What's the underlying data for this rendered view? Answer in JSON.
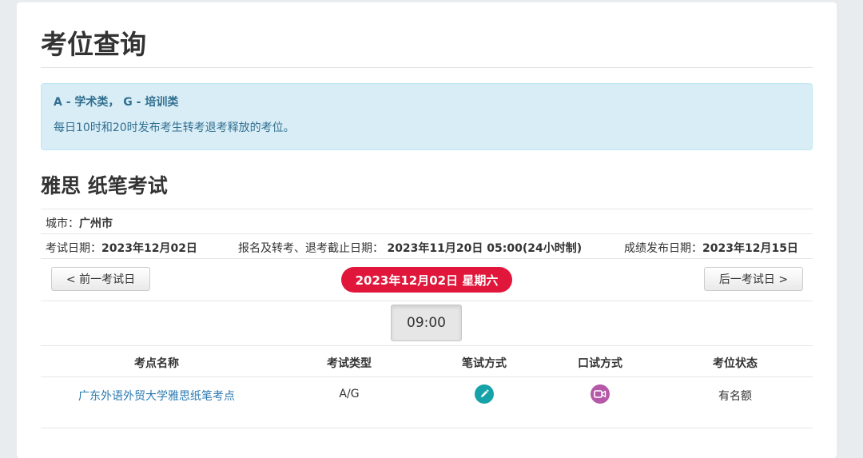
{
  "page": {
    "title": "考位查询"
  },
  "notice": {
    "legend": "A - 学术类， G - 培训类",
    "text": "每日10时和20时发布考生转考退考释放的考位。"
  },
  "exam": {
    "title": "雅思 纸笔考试"
  },
  "info": {
    "city_label": "城市：",
    "city_value": "广州市",
    "exam_date_label": "考试日期：",
    "exam_date_value": "2023年12月02日",
    "deadline_label": "报名及转考、退考截止日期：",
    "deadline_value": "2023年11月20日 05:00(24小时制)",
    "result_label": "成绩发布日期：",
    "result_value": "2023年12月15日"
  },
  "nav": {
    "prev_label": "< 前一考试日",
    "current_date": "2023年12月02日 星期六",
    "next_label": "后一考试日 >",
    "time_slot": "09:00",
    "current_color": "#e0173a"
  },
  "table": {
    "headers": [
      "考点名称",
      "考试类型",
      "笔试方式",
      "口试方式",
      "考位状态"
    ],
    "rows": [
      {
        "center": "广东外语外贸大学雅思纸笔考点",
        "type": "A/G",
        "written_icon": "pencil-icon",
        "speaking_icon": "video-icon",
        "status": "有名额"
      }
    ]
  },
  "colors": {
    "written_icon": "#16a2a8",
    "speaking_icon": "#b558a8",
    "link": "#2a7ab0",
    "notice_bg": "#d9edf7"
  }
}
